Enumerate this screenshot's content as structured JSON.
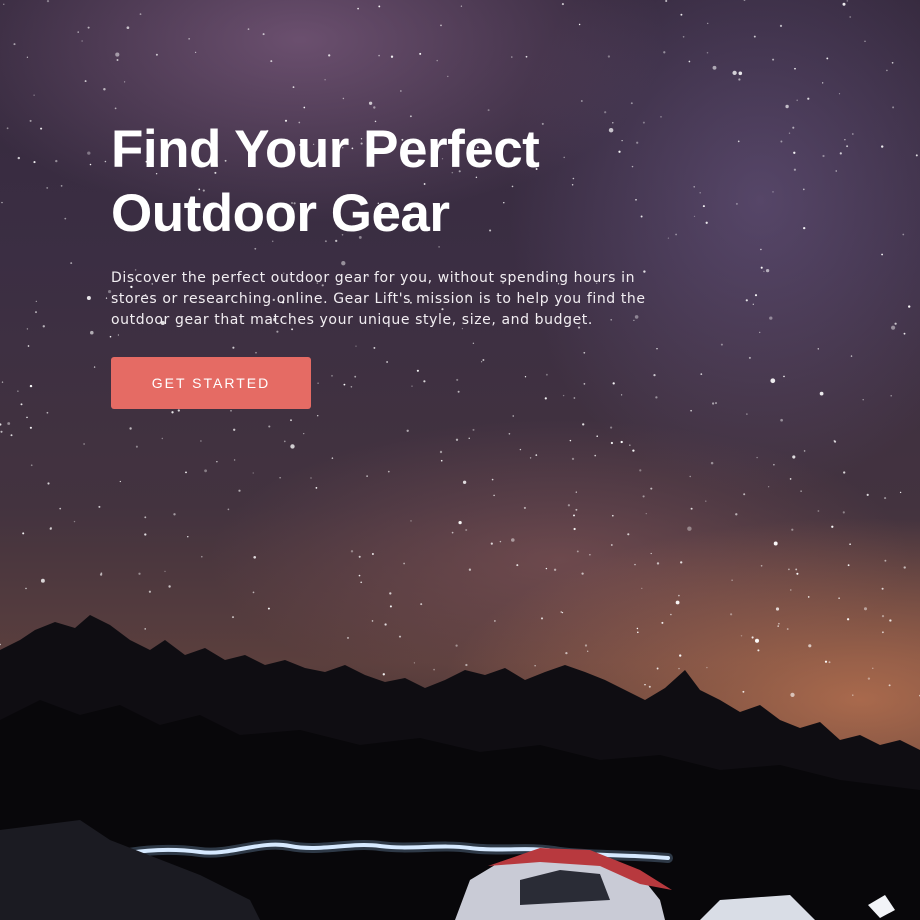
{
  "hero": {
    "headline": "Find Your Perfect Outdoor Gear",
    "description": "Discover the perfect outdoor gear for you, without spending hours in stores or researching online. Gear Lift's mission is to help you find the outdoor gear that matches your unique style, size, and budget.",
    "cta_label": "GET STARTED",
    "background_image": "starry-night-campsite"
  },
  "colors": {
    "cta_background": "#e56b64",
    "headline_text": "#ffffff",
    "body_text": "#f2eef2"
  }
}
